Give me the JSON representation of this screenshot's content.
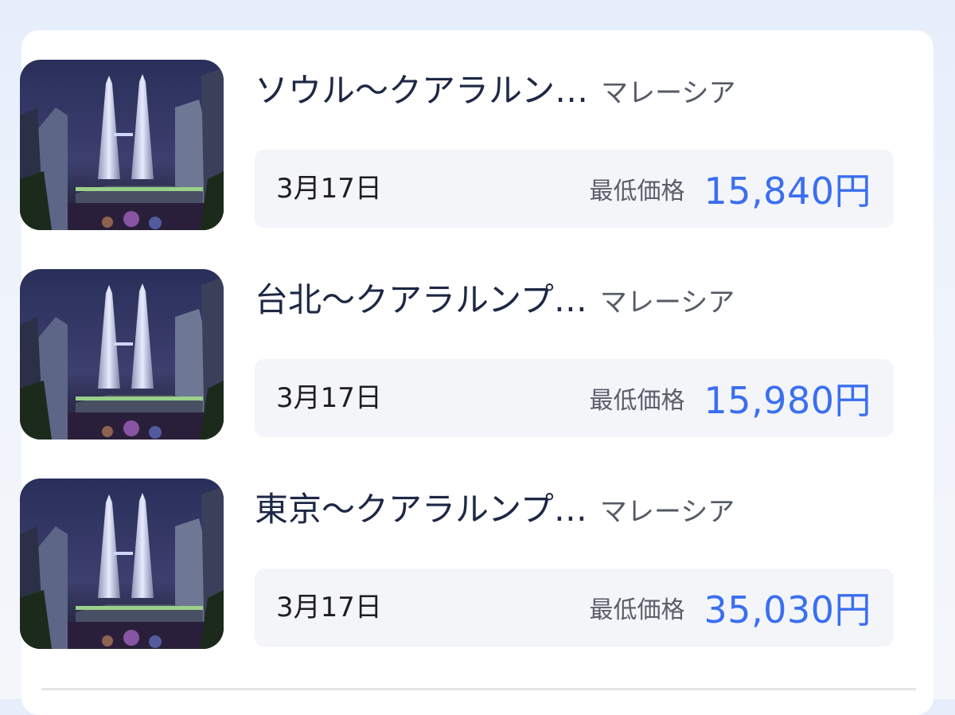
{
  "routes": [
    {
      "title": "ソウル〜クアラルン…",
      "country": "マレーシア",
      "date": "3月17日",
      "price_label": "最低価格",
      "price": "15,840円",
      "image_icon": "petronas-towers-photo"
    },
    {
      "title": "台北〜クアラルンプ…",
      "country": "マレーシア",
      "date": "3月17日",
      "price_label": "最低価格",
      "price": "15,980円",
      "image_icon": "petronas-towers-photo"
    },
    {
      "title": "東京〜クアラルンプ…",
      "country": "マレーシア",
      "date": "3月17日",
      "price_label": "最低価格",
      "price": "35,030円",
      "image_icon": "petronas-towers-photo"
    }
  ],
  "colors": {
    "price": "#3a6ff0",
    "title": "#1e2844",
    "box": "#f4f5f9"
  }
}
